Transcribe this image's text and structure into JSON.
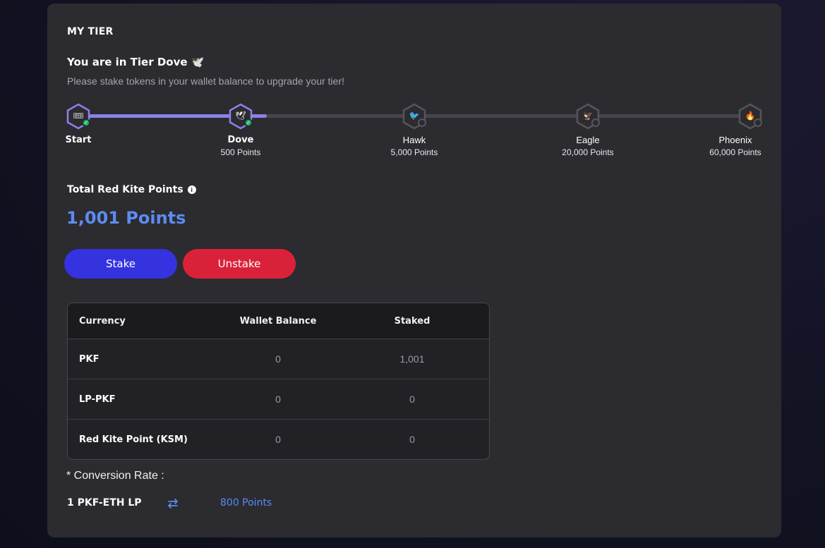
{
  "card": {
    "title": "MY TIER",
    "tier_line": "You are in Tier Dove 🕊️",
    "tier_sub": "Please stake tokens in your wallet balance to upgrade your tier!"
  },
  "progress": {
    "fill_fraction": 0.28,
    "accent": "#8b83e4",
    "tiers": [
      {
        "name": "Start",
        "points": "",
        "icon": "ticket-icon",
        "glyph": "🎟",
        "reached": true
      },
      {
        "name": "Dove",
        "points": "500 Points",
        "icon": "dove-icon",
        "glyph": "🕊",
        "reached": true
      },
      {
        "name": "Hawk",
        "points": "5,000 Points",
        "icon": "hawk-icon",
        "glyph": "🐦",
        "reached": false
      },
      {
        "name": "Eagle",
        "points": "20,000 Points",
        "icon": "eagle-icon",
        "glyph": "🦅",
        "reached": false
      },
      {
        "name": "Phoenix",
        "points": "60,000 Points",
        "icon": "phoenix-icon",
        "glyph": "🔥",
        "reached": false
      }
    ]
  },
  "points": {
    "title": "Total Red Kite Points",
    "value": "1,001 Points",
    "color": "#5c8cf0"
  },
  "buttons": {
    "stake": "Stake",
    "unstake": "Unstake",
    "stake_color": "#3532e0",
    "unstake_color": "#d9223a"
  },
  "table": {
    "headers": [
      "Currency",
      "Wallet Balance",
      "Staked"
    ],
    "rows": [
      {
        "currency": "PKF",
        "wallet": "0",
        "staked": "1,001"
      },
      {
        "currency": "LP-PKF",
        "wallet": "0",
        "staked": "0"
      },
      {
        "currency": "Red Kite Point (KSM)",
        "wallet": "0",
        "staked": "0"
      }
    ]
  },
  "conversion": {
    "title": "* Conversion Rate :",
    "from": "1 PKF-ETH LP",
    "to": "800 Points",
    "icon": "swap-icon"
  }
}
